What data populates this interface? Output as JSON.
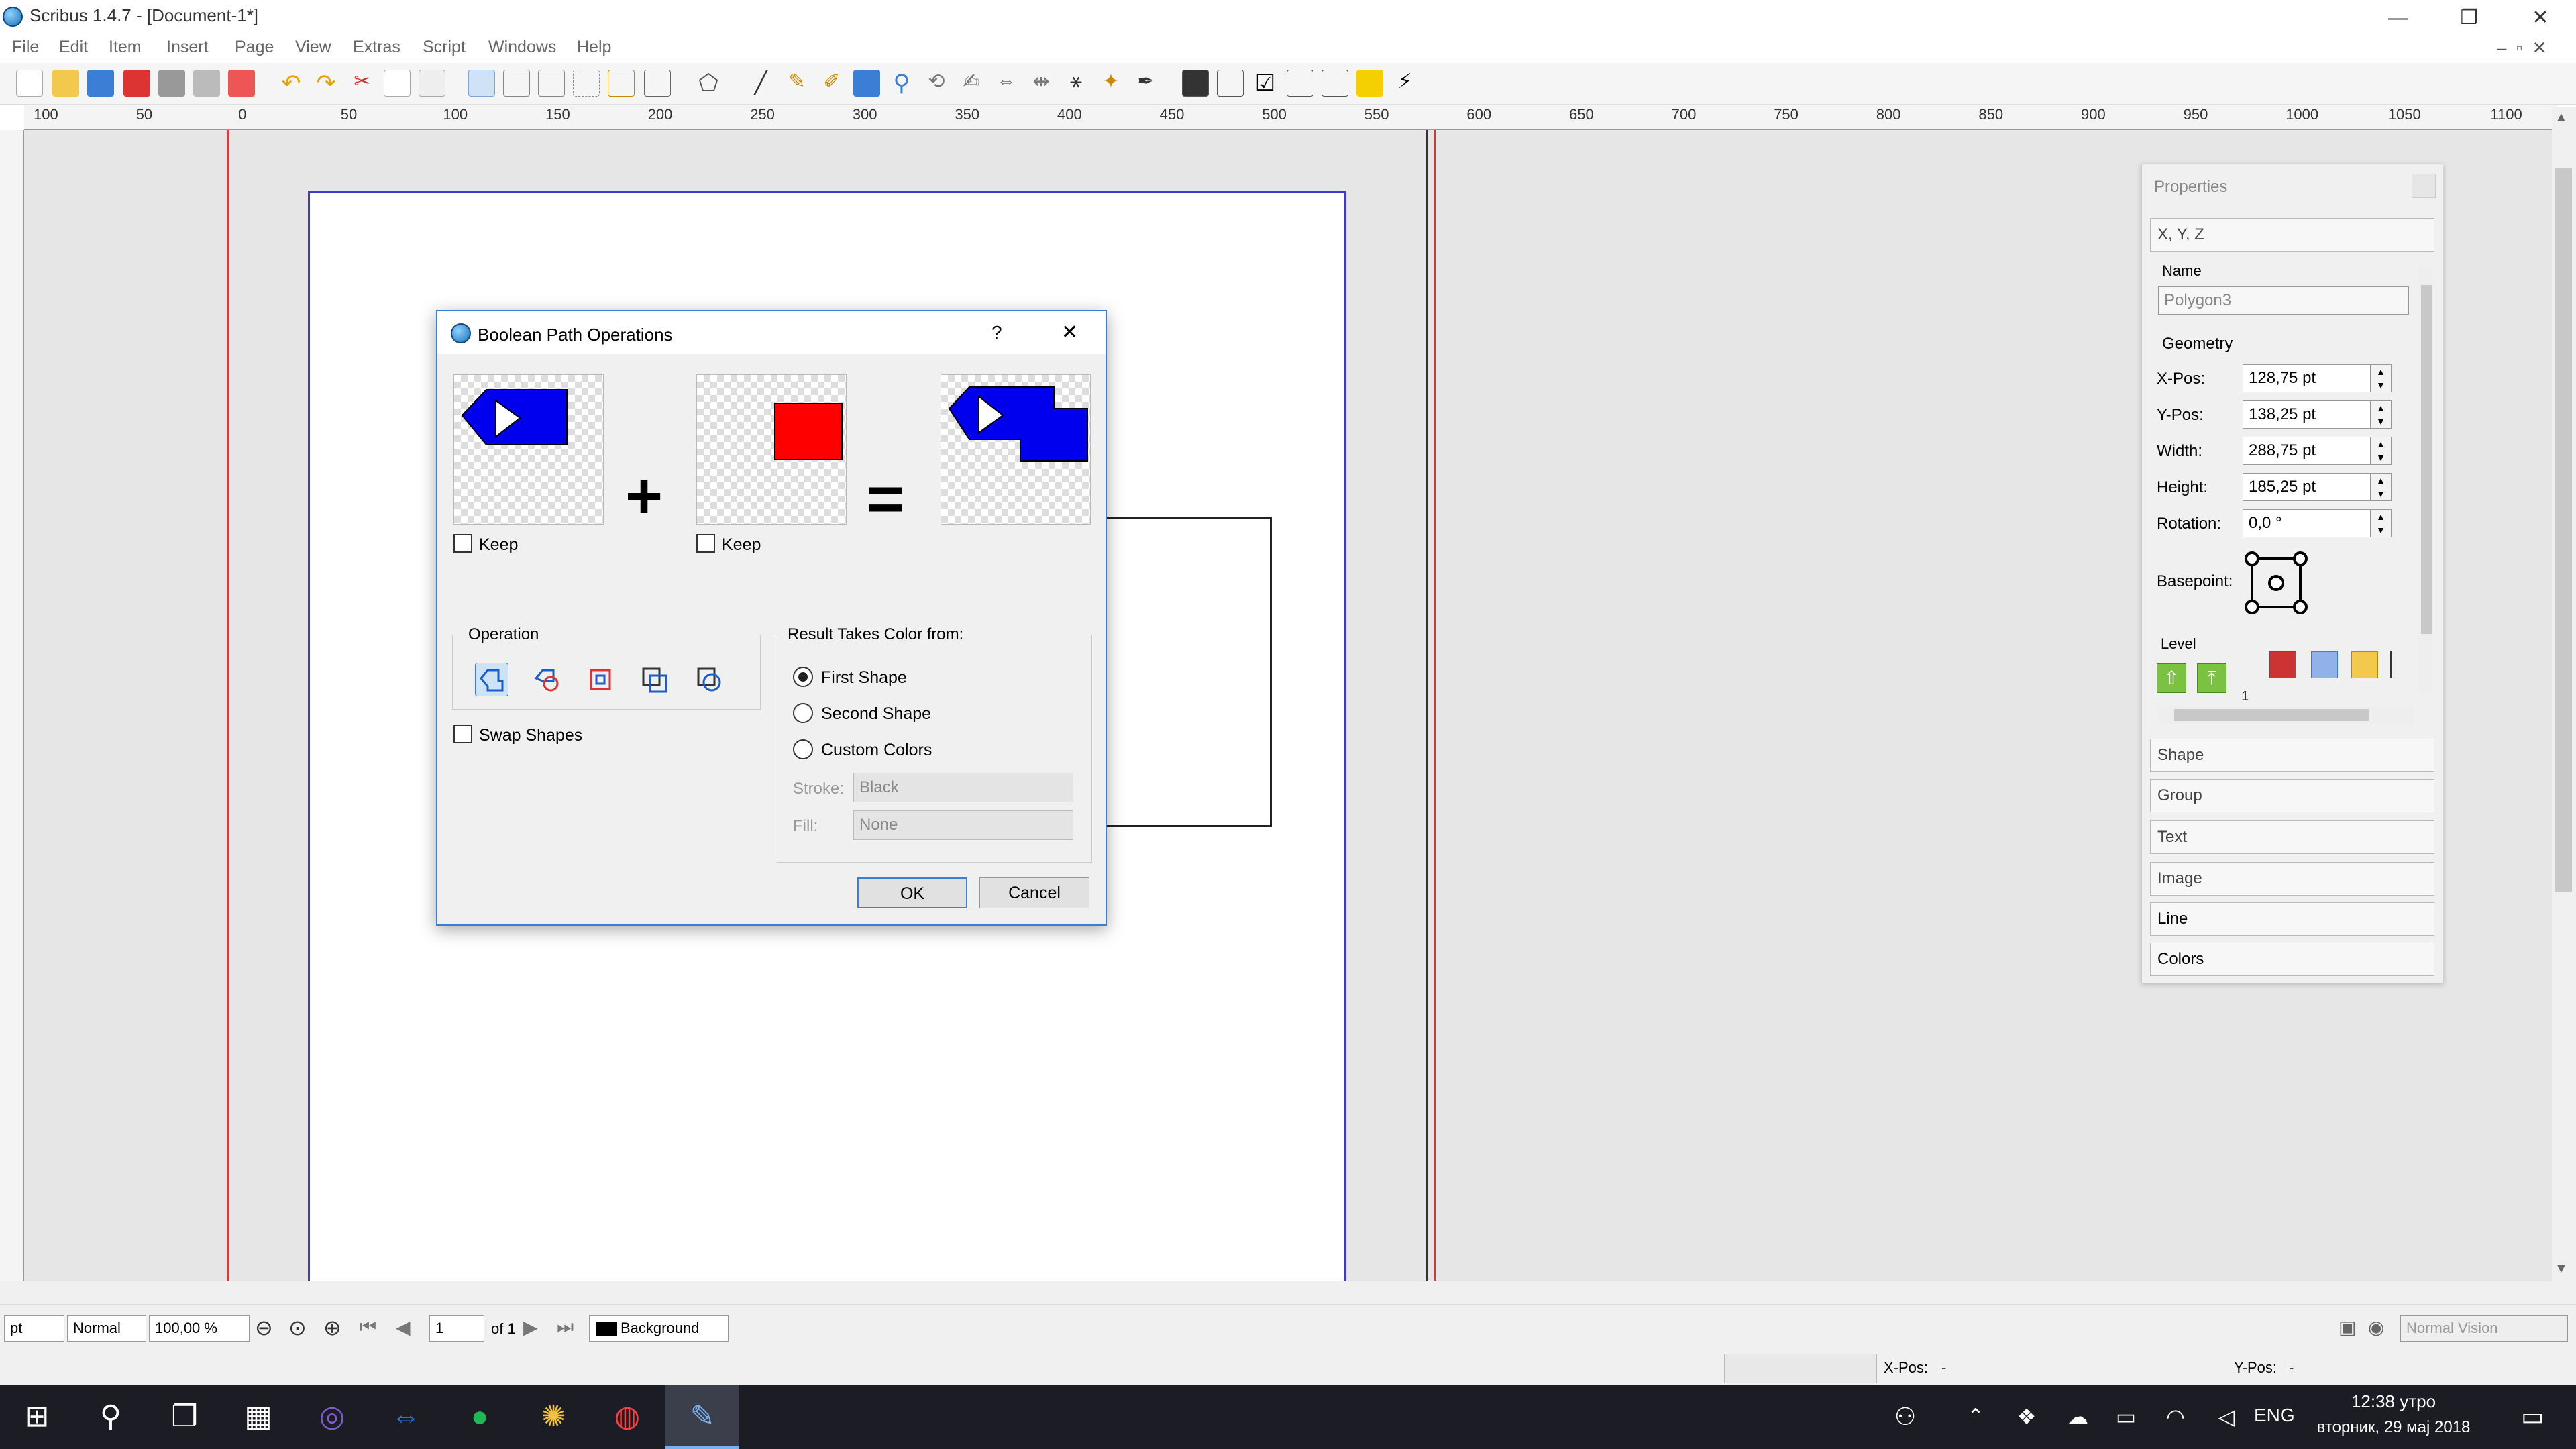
{
  "window": {
    "title": "Scribus 1.4.7 - [Document-1*]",
    "minimize": "—",
    "restore": "❐",
    "close": "✕"
  },
  "menu": [
    "File",
    "Edit",
    "Item",
    "Insert",
    "Page",
    "View",
    "Extras",
    "Script",
    "Windows",
    "Help"
  ],
  "ruler_labels": [
    "100",
    "50",
    "0",
    "50",
    "100",
    "150",
    "200",
    "250",
    "300",
    "350",
    "400",
    "450",
    "500",
    "550",
    "600",
    "650",
    "700",
    "750",
    "800",
    "850",
    "900",
    "950",
    "1000",
    "1050",
    "1100"
  ],
  "dialog": {
    "title": "Boolean Path Operations",
    "help": "?",
    "close": "✕",
    "plus": "+",
    "equals": "=",
    "keep1": "Keep",
    "keep2": "Keep",
    "operation_label": "Operation",
    "swap_shapes": "Swap Shapes",
    "result_label": "Result Takes Color from:",
    "radio_first": "First Shape",
    "radio_second": "Second Shape",
    "radio_custom": "Custom Colors",
    "stroke_label": "Stroke:",
    "stroke_value": "Black",
    "fill_label": "Fill:",
    "fill_value": "None",
    "ok": "OK",
    "cancel": "Cancel",
    "colors": {
      "shape_blue": "#0000ee",
      "shape_red": "#ff0000"
    }
  },
  "properties": {
    "title": "Properties",
    "section_xyz": "X, Y, Z",
    "name_label": "Name",
    "name_value": "Polygon3",
    "geometry_label": "Geometry",
    "xpos_label": "X-Pos:",
    "xpos": "128,75 pt",
    "ypos_label": "Y-Pos:",
    "ypos": "138,25 pt",
    "width_label": "Width:",
    "width": "288,75 pt",
    "height_label": "Height:",
    "height": "185,25 pt",
    "rotation_label": "Rotation:",
    "rotation": "0,0 °",
    "basepoint_label": "Basepoint:",
    "level_label": "Level",
    "level_value": "1",
    "sections": [
      "Shape",
      "Group",
      "Text",
      "Image",
      "Line",
      "Colors"
    ]
  },
  "statusbar": {
    "unit": "pt",
    "mode": "Normal",
    "zoom": "100,00 %",
    "page": "1",
    "of_pages": "of 1",
    "layer": "Background",
    "vision": "Normal Vision",
    "xpos_label": "X-Pos:",
    "xpos_value": "-",
    "ypos_label": "Y-Pos:",
    "ypos_value": "-"
  },
  "taskbar": {
    "lang": "ENG",
    "time": "12:38 утро",
    "date": "вторник, 29 мај 2018"
  }
}
